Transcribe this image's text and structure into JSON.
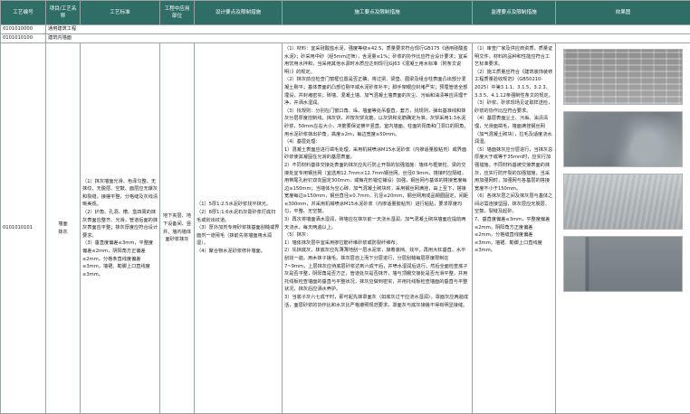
{
  "headers": {
    "code": "工艺编号",
    "item": "项目/工艺名称",
    "standard": "工艺标准",
    "node": "工程中应用部位",
    "design": "设计要点及限制措施",
    "construction": "施工要点及限制措施",
    "supervision": "监理要点及限制措施",
    "effect": "效果图"
  },
  "sections": [
    {
      "code": "0101010000",
      "name": "通用建筑工程"
    },
    {
      "code": "0101010100",
      "name": "建筑内墙面"
    }
  ],
  "row": {
    "code": "0101010101",
    "item": "墙面\n抹灰",
    "standard": "（1）抹灰墙面光滑、色泽匀整、无抹纹、无脱层、空鼓、面层应无爆灰和裂缝，接槎平整，分格缝及灰线清晰美观。\n（2）护角、孔洞、槽、盒四周的抹灰表面应整齐、光滑，管道后面的抹灰表面应平整；抹灰厚度应符合设计要求。\n（3）垂直度偏差≤3mm，平整度偏差≤2mm，阴阳角方正偏差≤2mm，分格条直线度偏差≤3mm，墙裙、勒脚上口直线度≤3mm。",
    "node": "地下夹层、地下设备间、竖井、墙内墙体面砂浆抹灰",
    "design": "（1）5厚1:2.5水泥砂浆找平抹光。\n（2）8厚1:1:6水泥石灰膏砂浆打底扫毛或划出纹道。\n（3）厚外加剂专用砂浆抹基面刮糙或界面剂一道甩毛（抹前先将墙面用水润湿）。\n（4）聚合物水泥砂浆修补墙面。",
    "construction": "（1）材料：宜采硅酸盐水泥，强度等级≥42.5，质量要求符合现行GB175《通用硅酸盐水泥》；砂采用中砂（经5mm过筛），含泥量≤1%；砂浆的协作比应符合设计要求；宜采用饮用水拌和，当采用其他水源时水质应达到现行JGJ63《混凝土用水标准（附条文说明）》的规定。\n（2）抹灰前应检查门窗框位置是否正确，将过梁、梁垫、圈梁及组合柱表面凸出部分混凝土剔平；基体表面的凸部位剔平或水泥砂浆补平；脚手架眼应封堵严实；预埋管道全部埋设，并封堵密实；砖墙、混凝土墙、加气混凝土墙表面的灰尘、污垢和油渍等应清理干净，并洒水湿润。\n（3）找规则：分别在门窗口角、垛、墙面等处吊垂直，套方，找规则，弹出基准线和抹灰分层厚度控制线，抹灰饼，并按灰饼充筋。以灰饼和充筋确定为准。灰饼采用1:3水泥砂浆，50mm左右大小，冲筋要保证横平竖直。室内墙面、柱面的阳角和门洞口的阳角，用水泥砂浆抹出护角，高度≥2m，每边宽度≥50mm。\n（4）基层处理：\n1）混凝土表面应进行凿毛处理，采用机械喷涂M15水泥砂浆（内掺适量胶粘剂）或界面砂浆使其凝固在光滑的基层表面。\n2）不同材料基体交接处表面的抹灰应先行防止开裂的加强措施：墙体与框架柱、梁的交接处宜专用钢丝网（宜选用12.7mm×12.7mm钢丝网，丝径0.9mm，搭接时应隔缝，用带尾孔射钉双向固定300mm，或梅花形错位铺设）加强，钢丝网与基体的搭接宽度每边≥150mm；当墙体为空心砖、加气混凝土砌块时，采用钢丝网满挂，由上至下，搭接宽度每边≥150mm，钢丝直径≥0.7mm，孔径≤20mm，钢丝网用成品钢圈固定，间距≤300mm，并采用机械喷涂M15水泥砂浆（内掺适量胶粘剂）进行粘贴，要求厚度均匀，平整、无空鼓。\n3）再次将墙面洒水湿润，砖墙应在抹灰前一天浇水湿润，加气混凝土砌块墙面应提前两天浇水，每天两遍以上。\n（5）抹灰：\n1）墙体抹灰层中宜采用掺拉筋纤维砂浆或防裂纤维布。\n2）先抹底灰，抹底灰应先薄薄地刮一层水泥浆，接着装档、找平，再用大杠垂直、水平刮找一遍，用木抹子搓毛。抹灰层自上而下分层进行，分层刮糙每层厚度限制在7~9mm，上层抹灰应待底层砂浆达到六成干后，并喷水湿润后进行。然后全面检查底子灰是否平整，阴阳角是否方正，管道处灰是否抹齐，墙与顶棚交接处是否光滑平整，并用托线板检查墙面的垂直与平整状况，抹灰应做到密实，并用托线板检查墙面的垂直与平整状况，抹灰后应洒水养护。\n3）当底子灰六七成干时，即可起先抹罩面灰（如底灰过干应浇水湿润）。罩面灰应两遍成活，面层砂浆的协作比和水灰比严格遵照规范要求，罩面灰与底灰接槎不得有明显接缝。",
    "supervision": "（1）审查厂家及供应商资质，质量证明文件，材料的品种和性能应符合工艺标准要求。\n（2）施工质量应符合《建筑装饰装修工程质量验收规范》（GB50210-2025）中第3.1.1、3.1.5、3.2.3、3.3.5、4.1.12条强制性条文的规定。\n（3）砂浆、砂浆现场见证取样送检，砂浆的协作比应符合要求。\n（4）基层表面尘土、污垢、油渍清理，光滑面凿毛，墙面满挂钢丝网（加气混凝土砌块），拉毛及适度浇水润湿。\n（5）墙面抹灰应分层进行，当抹灰总厚度大于或等于35mm时，应实行加强措施。不同材料基被交接表面的抹灰，应实行防开裂的加强措施，当采用加强网时，加强网与各基层的搭接宽度不小于150mm。\n（6）各抹灰层之间及抹灰层与基体之间必需连接坚固，抹灰层应无脱层、空鼓，裂缝及起砂。\n7、垂直度偏差≤3mm，平整度偏差≤2mm，阴阳角方正度偏差≤2mm，分格缝直线度偏差≤3mm，墙裙、勒脚上口直线度≤3mm。"
  },
  "images": [
    "wall-photo-1",
    "wall-photo-2",
    "wall-photo-3",
    "wall-photo-4"
  ]
}
